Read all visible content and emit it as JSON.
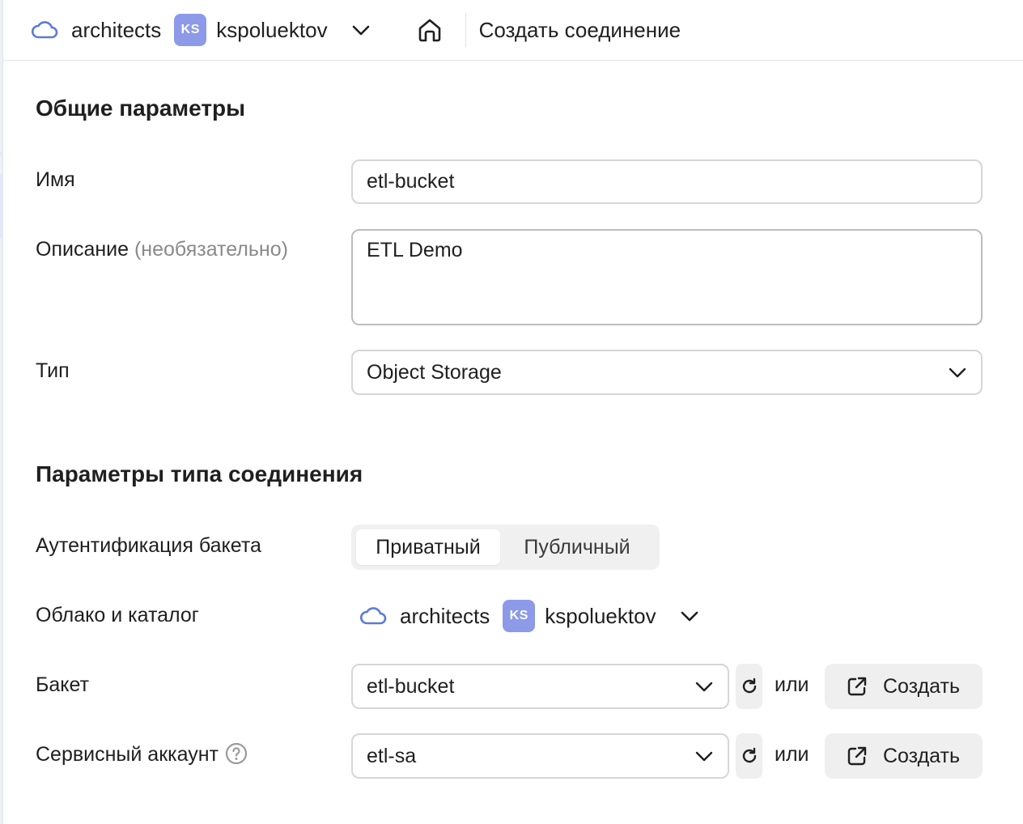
{
  "header": {
    "cloud": "architects",
    "folder_badge": "KS",
    "folder": "kspoluektov",
    "page_title": "Создать соединение"
  },
  "general": {
    "title": "Общие параметры",
    "name_label": "Имя",
    "name_value": "etl-bucket",
    "description_label": "Описание",
    "description_optional": "(необязательно)",
    "description_value": "ETL Demo",
    "type_label": "Тип",
    "type_value": "Object Storage"
  },
  "connection": {
    "title": "Параметры типа соединения",
    "auth_label": "Аутентификация бакета",
    "auth_options": [
      "Приватный",
      "Публичный"
    ],
    "auth_selected": "Приватный",
    "cloud_folder_label": "Облако и каталог",
    "cloud": "architects",
    "folder_badge": "KS",
    "folder": "kspoluektov",
    "bucket_label": "Бакет",
    "bucket_value": "etl-bucket",
    "sa_label": "Сервисный аккаунт",
    "sa_value": "etl-sa",
    "or_text": "или",
    "create_label": "Создать"
  },
  "colors": {
    "badge": "#8c9ae8",
    "cloud_icon": "#5b7bd8",
    "button_bg": "#efefef"
  }
}
